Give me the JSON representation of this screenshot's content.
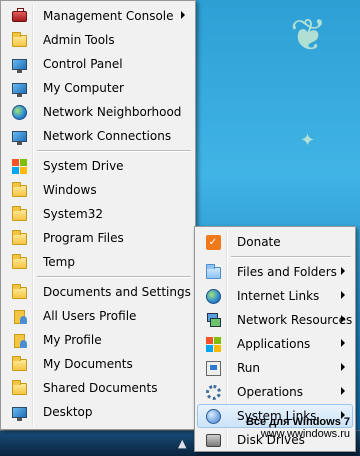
{
  "main_menu": {
    "items": [
      {
        "label": "Management Console",
        "icon": "toolbox-icon",
        "submenu": true
      },
      {
        "label": "Admin Tools",
        "icon": "folder-icon"
      },
      {
        "label": "Control Panel",
        "icon": "control-panel-icon"
      },
      {
        "label": "My Computer",
        "icon": "computer-icon"
      },
      {
        "label": "Network Neighborhood",
        "icon": "network-neighborhood-icon"
      },
      {
        "label": "Network Connections",
        "icon": "network-connections-icon"
      },
      {
        "label": "System Drive",
        "icon": "system-drive-icon"
      },
      {
        "label": "Windows",
        "icon": "folder-icon"
      },
      {
        "label": "System32",
        "icon": "folder-icon"
      },
      {
        "label": "Program Files",
        "icon": "folder-icon"
      },
      {
        "label": "Temp",
        "icon": "folder-icon"
      },
      {
        "label": "Documents and Settings",
        "icon": "folder-icon"
      },
      {
        "label": "All Users Profile",
        "icon": "users-profile-icon"
      },
      {
        "label": "My Profile",
        "icon": "profile-icon"
      },
      {
        "label": "My Documents",
        "icon": "folder-icon"
      },
      {
        "label": "Shared Documents",
        "icon": "folder-icon"
      },
      {
        "label": "Desktop",
        "icon": "desktop-icon"
      }
    ]
  },
  "sub_menu": {
    "items": [
      {
        "label": "Donate",
        "icon": "donate-icon"
      },
      {
        "label": "Files and Folders",
        "icon": "files-folders-icon",
        "submenu": true
      },
      {
        "label": "Internet Links",
        "icon": "globe-icon",
        "submenu": true
      },
      {
        "label": "Network Resources",
        "icon": "network-resources-icon",
        "submenu": true
      },
      {
        "label": "Applications",
        "icon": "windows-logo-icon",
        "submenu": true
      },
      {
        "label": "Run",
        "icon": "run-icon",
        "submenu": true
      },
      {
        "label": "Operations",
        "icon": "operations-icon",
        "submenu": true
      },
      {
        "label": "System Links",
        "icon": "system-links-icon",
        "submenu": true,
        "highlighted": true
      },
      {
        "label": "Disk Drives",
        "icon": "disk-drive-icon"
      }
    ]
  },
  "watermark": {
    "line1": "Все для Windows 7",
    "line2": "www.wwindows.ru"
  },
  "colors": {
    "menu_bg": "#f1f1f1",
    "highlight": "#cce3f8",
    "desktop": "#2d9fd4"
  }
}
